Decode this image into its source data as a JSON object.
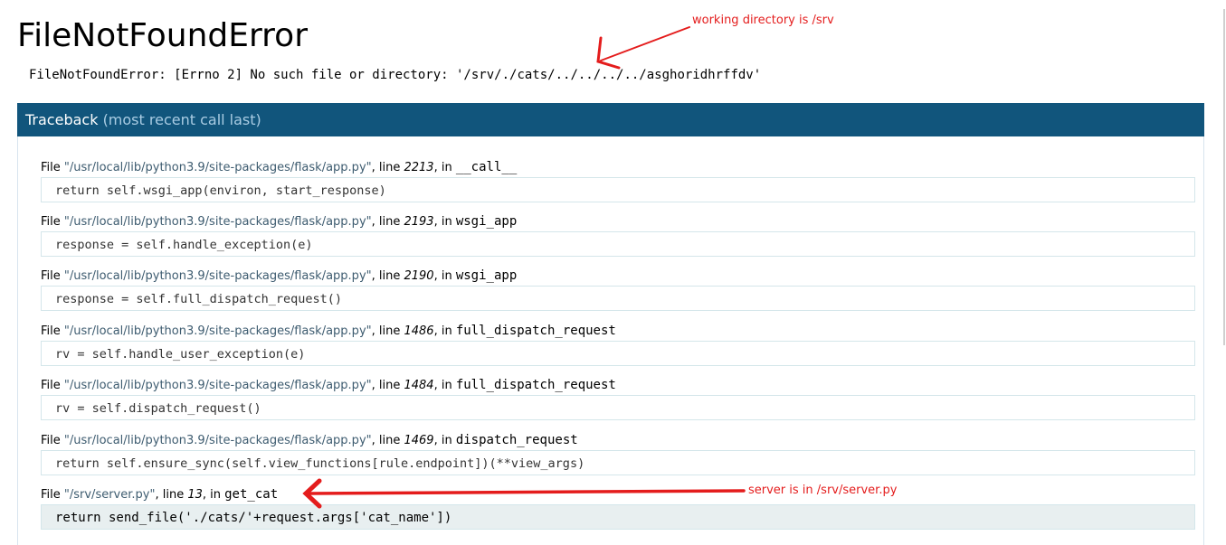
{
  "title": "FileNotFoundError",
  "error_message": "FileNotFoundError: [Errno 2] No such file or directory: '/srv/./cats/../../../../asghoridhrffdv'",
  "traceback": {
    "header": "Traceback",
    "subheader": "(most recent call last)",
    "frames": [
      {
        "file": "\"/usr/local/lib/python3.9/site-packages/flask/app.py\"",
        "line": "2213",
        "func": "__call__",
        "code": "return self.wsgi_app(environ, start_response)"
      },
      {
        "file": "\"/usr/local/lib/python3.9/site-packages/flask/app.py\"",
        "line": "2193",
        "func": "wsgi_app",
        "code": "response = self.handle_exception(e)"
      },
      {
        "file": "\"/usr/local/lib/python3.9/site-packages/flask/app.py\"",
        "line": "2190",
        "func": "wsgi_app",
        "code": "response = self.full_dispatch_request()"
      },
      {
        "file": "\"/usr/local/lib/python3.9/site-packages/flask/app.py\"",
        "line": "1486",
        "func": "full_dispatch_request",
        "code": "rv = self.handle_user_exception(e)"
      },
      {
        "file": "\"/usr/local/lib/python3.9/site-packages/flask/app.py\"",
        "line": "1484",
        "func": "full_dispatch_request",
        "code": "rv = self.dispatch_request()"
      },
      {
        "file": "\"/usr/local/lib/python3.9/site-packages/flask/app.py\"",
        "line": "1469",
        "func": "dispatch_request",
        "code": "return self.ensure_sync(self.view_functions[rule.endpoint])(**view_args)"
      },
      {
        "file": "\"/srv/server.py\"",
        "line": "13",
        "func": "get_cat",
        "code": "return send_file('./cats/'+request.args['cat_name'])"
      }
    ]
  },
  "labels": {
    "file": "File ",
    "line": ", line ",
    "in": ", in "
  },
  "annotations": {
    "working_dir": "working directory is /srv",
    "server_location": "server is in /srv/server.py"
  },
  "colors": {
    "header_bg": "#11557c",
    "annotation": "#e41c1c"
  }
}
